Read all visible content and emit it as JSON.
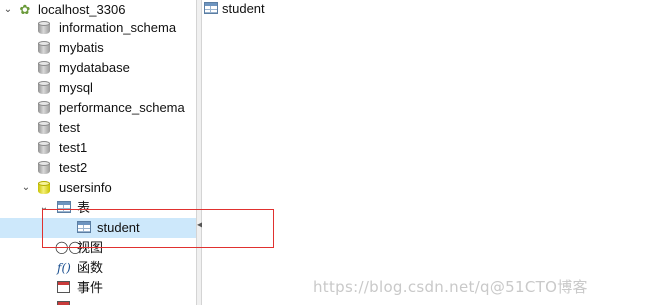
{
  "tree": {
    "connection": "localhost_3306",
    "databases": [
      "information_schema",
      "mybatis",
      "mydatabase",
      "mysql",
      "performance_schema",
      "test",
      "test1",
      "test2"
    ],
    "open_database": "usersinfo",
    "tables_group": "表",
    "selected_table": "student",
    "views_group": "视图",
    "functions_group": "函数",
    "events_group": "事件",
    "fn_icon_text": "f()"
  },
  "main": {
    "tab_label": "student"
  },
  "watermark": "https://blog.csdn.net/q@51CTO博客"
}
